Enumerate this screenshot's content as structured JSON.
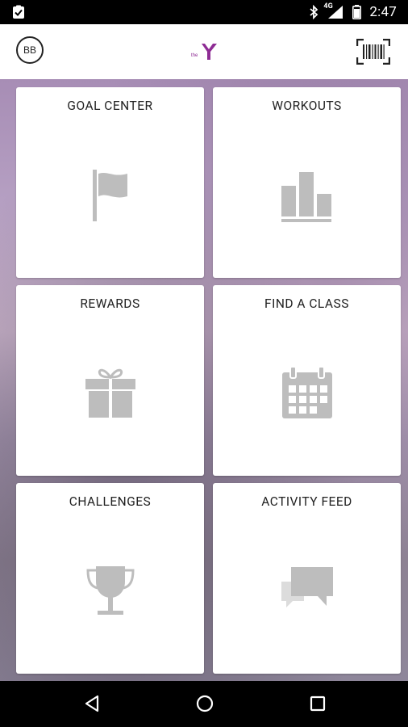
{
  "status_bar": {
    "network": "4G",
    "time": "2:47"
  },
  "app_bar": {
    "avatar_initials": "BB",
    "logo": "the Y",
    "barcode_icon": "barcode-scan-icon"
  },
  "tiles": [
    {
      "label": "GOAL CENTER",
      "icon": "flag-icon"
    },
    {
      "label": "WORKOUTS",
      "icon": "bar-chart-icon"
    },
    {
      "label": "REWARDS",
      "icon": "gift-icon"
    },
    {
      "label": "FIND A CLASS",
      "icon": "calendar-icon"
    },
    {
      "label": "CHALLENGES",
      "icon": "trophy-icon"
    },
    {
      "label": "ACTIVITY FEED",
      "icon": "chat-bubbles-icon"
    }
  ],
  "nav_bar": {
    "back": "back-icon",
    "home": "home-icon",
    "recents": "recents-icon"
  },
  "colors": {
    "icon_gray": "#bdbdbd",
    "brand_purple": "#8e2c94"
  }
}
